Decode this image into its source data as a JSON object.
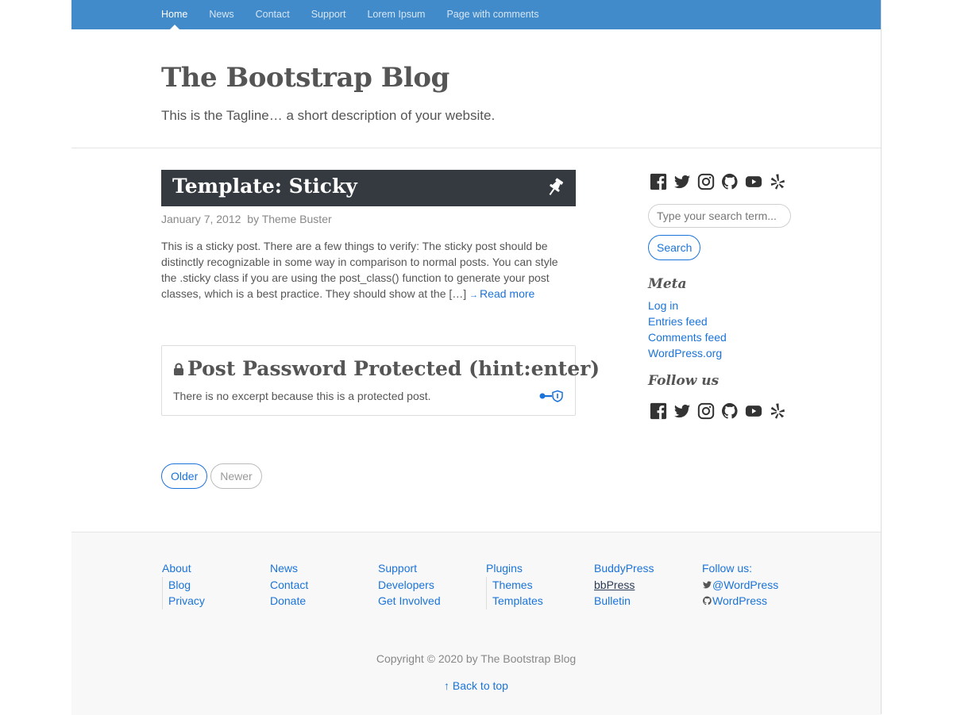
{
  "nav": {
    "items": [
      {
        "label": "Home"
      },
      {
        "label": "News"
      },
      {
        "label": "Contact"
      },
      {
        "label": "Support"
      },
      {
        "label": "Lorem Ipsum"
      },
      {
        "label": "Page with comments"
      }
    ],
    "active": "Home",
    "colors": {
      "bar": "#428bca",
      "active_text": "#ffffff",
      "text": "#d6e6f5"
    }
  },
  "header": {
    "title": "The Bootstrap Blog",
    "tagline": "This is the Tagline… a short description of your website."
  },
  "posts": {
    "sticky": {
      "title": "Template: Sticky",
      "date": "January 7, 2012",
      "author": "by Theme Buster",
      "excerpt": "This is a sticky post. There are a few things to verify: The sticky post should be distinctly recognizable in some way in comparison to normal posts. You can style the .sticky class if you are using the post_class() function to generate your post classes, which is a best practice. They should show at the […]",
      "read_more": "Read more",
      "read_more_arrow": "→",
      "icon": "pushpin-icon"
    },
    "protected": {
      "title": "Post Password Protected (hint:enter)",
      "text": "There is no excerpt because this is a protected post.",
      "icons": [
        "lock-icon",
        "key-shield-icon"
      ]
    }
  },
  "pager": {
    "older": "Older",
    "newer": "Newer"
  },
  "sidebar": {
    "social_icons": [
      "facebook-icon",
      "twitter-icon",
      "instagram-icon",
      "github-icon",
      "youtube-icon",
      "yelp-icon"
    ],
    "search": {
      "placeholder": "Type your search term...",
      "value": "",
      "button": "Search"
    },
    "meta": {
      "title": "Meta",
      "links": [
        {
          "label": "Log in"
        },
        {
          "label": "Entries feed"
        },
        {
          "label": "Comments feed"
        },
        {
          "label": "WordPress.org"
        }
      ]
    },
    "follow": {
      "title": "Follow us"
    }
  },
  "footer": {
    "columns": [
      {
        "head": "About",
        "items": [
          "Blog",
          "Privacy"
        ]
      },
      {
        "head": "News",
        "items": [
          "Contact",
          "Donate"
        ]
      },
      {
        "head": "Support",
        "items": [
          "Developers",
          "Get Involved"
        ]
      },
      {
        "head": "Plugins",
        "items": [
          "Themes",
          "Templates"
        ]
      },
      {
        "head": "BuddyPress",
        "items": [
          "bbPress",
          "Bulletin"
        ]
      },
      {
        "head": "Follow us:",
        "items": [
          "@WordPress",
          "WordPress"
        ]
      }
    ],
    "copyright": "Copyright © 2020 by The Bootstrap Blog",
    "back_to_top": "↑ Back to top"
  },
  "colors": {
    "link": "#1a73d9",
    "text": "#555555",
    "muted": "#888888",
    "sticky_bg": "#343a40"
  }
}
